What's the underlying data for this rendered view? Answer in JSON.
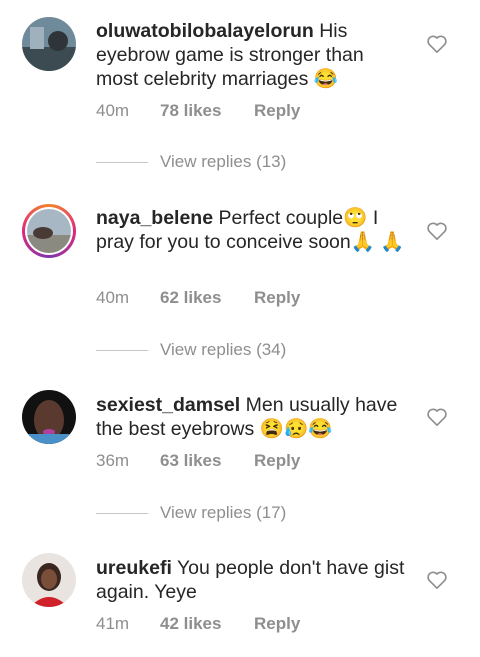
{
  "comments": [
    {
      "username": "oluwatobilobalayelorun",
      "text": "His eyebrow game is stronger than most celebrity marriages 😂",
      "time": "40m",
      "likes": "78 likes",
      "reply": "Reply",
      "view_replies": "View replies (13)",
      "avatar_icon": "avatar-photo"
    },
    {
      "username": "naya_belene",
      "text": "Perfect couple🙄 I pray for you to conceive soon🙏 🙏",
      "time": "40m",
      "likes": "62 likes",
      "reply": "Reply",
      "view_replies": "View replies (34)",
      "avatar_icon": "avatar-photo-story-ring"
    },
    {
      "username": "sexiest_damsel",
      "text": "Men usually have the best eyebrows 😫😥😂",
      "time": "36m",
      "likes": "63 likes",
      "reply": "Reply",
      "view_replies": "View replies (17)",
      "avatar_icon": "avatar-photo"
    },
    {
      "username": "ureukefi",
      "text": "You people don't have gist again. Yeye",
      "time": "41m",
      "likes": "42 likes",
      "reply": "Reply",
      "avatar_icon": "avatar-photo"
    }
  ],
  "colors": {
    "text": "#262626",
    "meta": "#8e8e8e",
    "divider": "#c7c7c7",
    "story_ring_start": "#f58529",
    "story_ring_end": "#dd2a7b"
  },
  "icons": {
    "like": "heart-outline-icon"
  }
}
